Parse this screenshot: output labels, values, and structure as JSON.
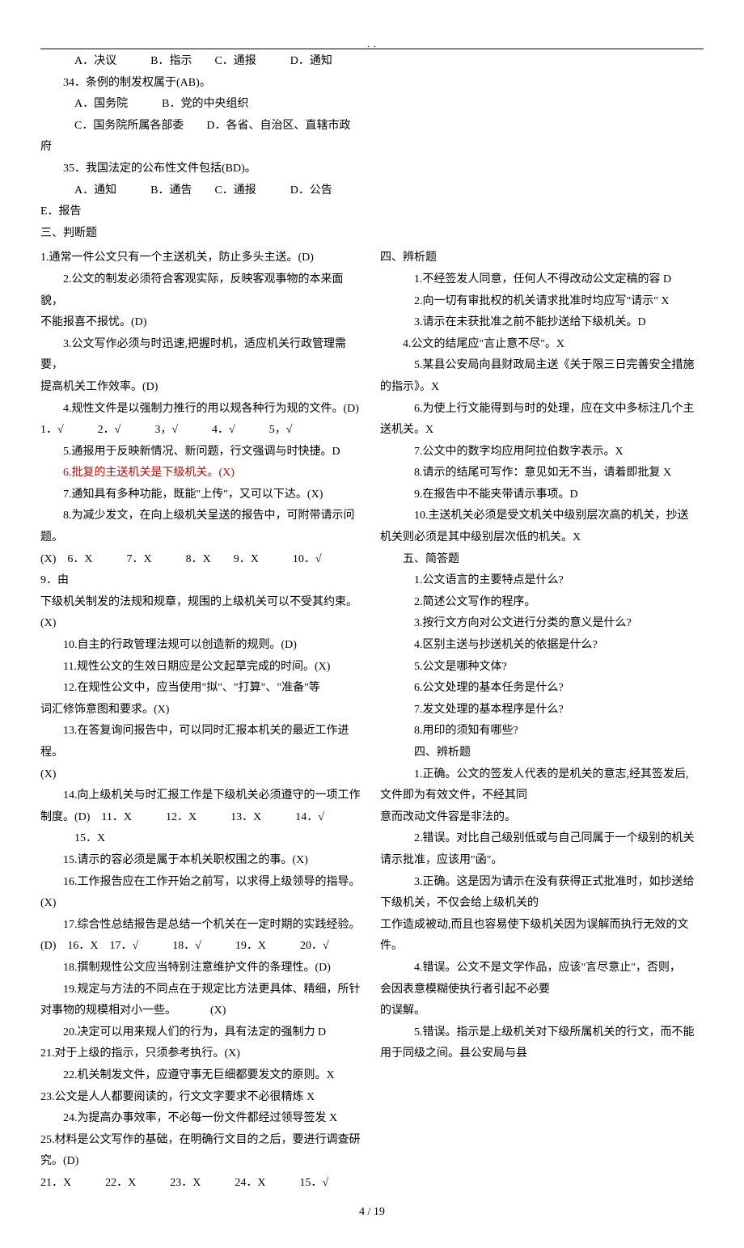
{
  "header_dots": ". .",
  "top": {
    "l33opts": "A．决议   B．指示  C．通报   D．通知",
    "q34": "34．条例的制发权属于(AB)。",
    "q34a": "A．国务院   B．党的中央组织",
    "q34b": "C．国务院所属各部委  D．各省、自治区、直辖市政",
    "q34c": "府",
    "q35": "35．我国法定的公布性文件包括(BD)。",
    "q35a": "A．通知   B．通告  C．通报   D．公告",
    "q35b": "E．报告",
    "sec3": "三、判断题"
  },
  "left": [
    {
      "t": "1.通常一件公文只有一个主送机关，防止多头主送。(D)",
      "cls": "line no-indent"
    },
    {
      "t": "2.公文的制发必须符合客观实际，反映客观事物的本来面貌，",
      "cls": "line"
    },
    {
      "t": "不能报喜不报忧。(D)",
      "cls": "line no-indent"
    },
    {
      "t": "3.公文写作必须与时迅速,把握时机，适应机关行政管理需要，",
      "cls": "line"
    },
    {
      "t": "提高机关工作效率。(D)",
      "cls": "line no-indent"
    },
    {
      "t": "4.规性文件是以强制力推行的用以规各种行为规的文件。(D)",
      "cls": "line"
    },
    {
      "t": "1．√   2．√   3，√   4．√   5，√",
      "cls": "line no-indent"
    },
    {
      "t": "5.通报用于反映新情况、新问题，行文强调与时快捷。D",
      "cls": "line"
    },
    {
      "t": "6.批复的主送机关是下级机关。(X)",
      "cls": "line red"
    },
    {
      "t": "7.通知具有多种功能，既能\"上传\"，又可以下达。(X)",
      "cls": "line"
    },
    {
      "t": "8.为减少发文，在向上级机关呈送的报告中，可附带请示问题。",
      "cls": "line"
    },
    {
      "t": "(X) 6．X   7．X   8．X  9．X   10．√   9．由",
      "cls": "line no-indent"
    },
    {
      "t": "下级机关制发的法规和规章，规围的上级机关可以不受其约束。(X)",
      "cls": "line no-indent"
    },
    {
      "t": "10.自主的行政管理法规可以创造新的规则。(D)",
      "cls": "line"
    },
    {
      "t": "11.规性公文的生效日期应是公文起草完成的时间。(X)",
      "cls": "line"
    },
    {
      "t": "12.在规性公文中，应当使用\"拟\"、\"打算\"、\"准备\"等",
      "cls": "line"
    },
    {
      "t": "词汇修饰意图和要求。(X)",
      "cls": "line no-indent"
    },
    {
      "t": "13.在答复询问报告中，可以同时汇报本机关的最近工作进程。",
      "cls": "line"
    },
    {
      "t": "(X)",
      "cls": "line no-indent"
    },
    {
      "t": "14.向上级机关与时汇报工作是下级机关必须遵守的一项工作",
      "cls": "line"
    },
    {
      "t": "制度。(D) 11．X   12．X   13．X   14．√",
      "cls": "line no-indent"
    },
    {
      "t": "15．X",
      "cls": "line indent3"
    },
    {
      "t": "15.请示的容必须是属于本机关职权围之的事。(X)",
      "cls": "line"
    },
    {
      "t": "16.工作报告应在工作开始之前写，以求得上级领导的指导。(X)",
      "cls": "line"
    },
    {
      "t": "17.综合性总结报告是总结一个机关在一定时期的实践经验。",
      "cls": "line"
    },
    {
      "t": "(D) 16．X 17．√   18．√   19．X   20．√",
      "cls": "line no-indent"
    },
    {
      "t": "18.撰制规性公文应当特别注意维护文件的条理性。(D)",
      "cls": "line"
    },
    {
      "t": "19.规定与方法的不同点在于规定比方法更具体、精细，所针",
      "cls": "line"
    },
    {
      "t": "对事物的规模相对小一些。   (X)",
      "cls": "line no-indent"
    },
    {
      "t": "20.决定可以用来规人们的行为，具有法定的强制力 D",
      "cls": "line"
    },
    {
      "t": "21.对于上级的指示，只须参考执行。(X)",
      "cls": "line no-indent"
    },
    {
      "t": "22.机关制发文件，应遵守事无巨细都要发文的原则。X",
      "cls": "line"
    },
    {
      "t": "23.公文是人人都要阅读的，行文文字要求不必很精炼 X",
      "cls": "line no-indent"
    },
    {
      "t": "24.为提高办事效率，不必每一份文件都经过领导签发 X",
      "cls": "line"
    },
    {
      "t": "25.材料是公文写作的基础，在明确行文目的之后，要进行调查研",
      "cls": "line no-indent"
    },
    {
      "t": "究。(D)",
      "cls": "line no-indent"
    },
    {
      "t": "21．X   22．X   23．X   24．X   15．√",
      "cls": "line no-indent"
    }
  ],
  "right": [
    {
      "t": "四、辨析题",
      "cls": "line no-indent"
    },
    {
      "t": "1.不经签发人同意，任何人不得改动公文定稿的容 D",
      "cls": "line indent3"
    },
    {
      "t": "2.向一切有审批权的机关请求批准时均应写\"请示\" X",
      "cls": "line indent3"
    },
    {
      "t": "3.请示在未获批准之前不能抄送给下级机关。D",
      "cls": "line indent3"
    },
    {
      "t": "4.公文的结尾应\"言止意不尽\"。X",
      "cls": "line"
    },
    {
      "t": "5.某县公安局向县财政局主送《关于限三日完善安全措施",
      "cls": "line indent3"
    },
    {
      "t": "的指示》。X",
      "cls": "line no-indent"
    },
    {
      "t": "6.为使上行文能得到与时的处理，应在文中多标注几个主",
      "cls": "line indent3"
    },
    {
      "t": "送机关。X",
      "cls": "line no-indent"
    },
    {
      "t": "7.公文中的数字均应用阿拉伯数字表示。X",
      "cls": "line indent3"
    },
    {
      "t": "8.请示的结尾可写作：意见如无不当，请着即批复 X",
      "cls": "line indent3"
    },
    {
      "t": "9.在报告中不能夹带请示事项。D",
      "cls": "line indent3"
    },
    {
      "t": "10.主送机关必须是受文机关中级别层次高的机关，抄送",
      "cls": "line indent3"
    },
    {
      "t": "机关则必须是其中级别层次低的机关。X",
      "cls": "line no-indent"
    },
    {
      "t": "五、简答题",
      "cls": "line"
    },
    {
      "t": "1.公文语言的主要特点是什么?",
      "cls": "line indent3"
    },
    {
      "t": "2.简述公文写作的程序。",
      "cls": "line indent3"
    },
    {
      "t": "3.按行文方向对公文进行分类的意义是什么?",
      "cls": "line indent3"
    },
    {
      "t": "4.区别主送与抄送机关的依据是什么?",
      "cls": "line indent3"
    },
    {
      "t": "5.公文是哪种文体?",
      "cls": "line indent3"
    },
    {
      "t": "6.公文处理的基本任务是什么?",
      "cls": "line indent3"
    },
    {
      "t": "7.发文处理的基本程序是什么?",
      "cls": "line indent3"
    },
    {
      "t": "8.用印的须知有哪些?",
      "cls": "line indent3"
    },
    {
      "t": "四、辨析题",
      "cls": "line indent3"
    },
    {
      "t": "1.正确。公文的签发人代表的是机关的意志,经其签发后,",
      "cls": "line indent3"
    },
    {
      "t": "文件即为有效文件，不经其同",
      "cls": "line no-indent"
    },
    {
      "t": "意而改动文件容是非法的。",
      "cls": "line no-indent"
    },
    {
      "t": "2.错误。对比自己级别低或与自己同属于一个级别的机关",
      "cls": "line indent3"
    },
    {
      "t": "请示批准，应该用\"函\"。",
      "cls": "line no-indent"
    },
    {
      "t": "3.正确。这是因为请示在没有获得正式批准时，如抄送给",
      "cls": "line indent3"
    },
    {
      "t": "下级机关，不仅会给上级机关的",
      "cls": "line no-indent"
    },
    {
      "t": "工作造成被动,而且也容易使下级机关因为误解而执行无效的文件。",
      "cls": "line no-indent"
    },
    {
      "t": "4.错误。公文不是文学作品，应该\"言尽意止\"，否则，",
      "cls": "line indent3"
    },
    {
      "t": "会因表意模糊使执行者引起不必要",
      "cls": "line no-indent"
    },
    {
      "t": "的误解。",
      "cls": "line no-indent"
    },
    {
      "t": "5.错误。指示是上级机关对下级所属机关的行文，而不能",
      "cls": "line indent3"
    },
    {
      "t": "用于同级之间。县公安局与县",
      "cls": "line no-indent"
    }
  ],
  "footer": "4 / 19"
}
